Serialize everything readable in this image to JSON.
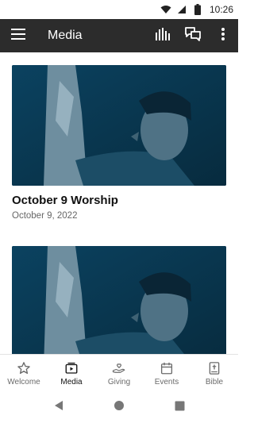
{
  "status_bar": {
    "time": "10:26"
  },
  "app_bar": {
    "title": "Media"
  },
  "media_items": [
    {
      "title": "October 9 Worship",
      "date": "October 9, 2022"
    },
    {
      "title": "",
      "date": ""
    }
  ],
  "bottom_nav": {
    "items": [
      {
        "label": "Welcome",
        "icon": "star-icon",
        "active": false
      },
      {
        "label": "Media",
        "icon": "media-icon",
        "active": true
      },
      {
        "label": "Giving",
        "icon": "giving-icon",
        "active": false
      },
      {
        "label": "Events",
        "icon": "calendar-icon",
        "active": false
      },
      {
        "label": "Bible",
        "icon": "bible-icon",
        "active": false
      }
    ]
  },
  "colors": {
    "app_bar": "#2c2c2c",
    "thumbnail_tint": "#0e3a52",
    "active_nav": "#111111",
    "inactive_nav": "#6b6b6b"
  }
}
